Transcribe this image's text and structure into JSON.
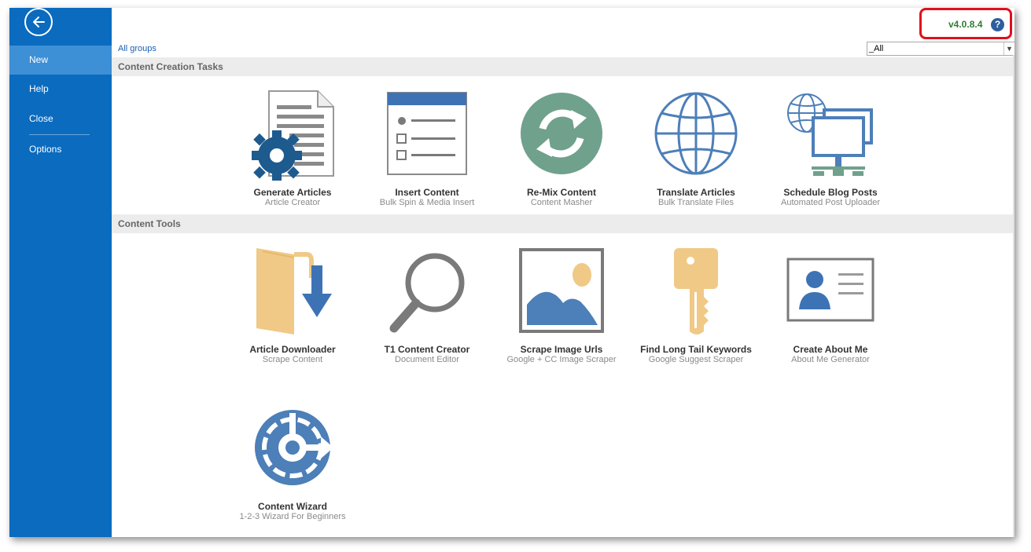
{
  "sidebar": {
    "items": [
      {
        "label": "New"
      },
      {
        "label": "Help"
      },
      {
        "label": "Close"
      },
      {
        "label": "Options"
      }
    ]
  },
  "header": {
    "version": "v4.0.8.4",
    "help_symbol": "?",
    "all_groups_link": "All groups",
    "group_filter_value": "_All"
  },
  "sections": [
    {
      "title": "Content Creation Tasks",
      "tiles": [
        {
          "title": "Generate Articles",
          "subtitle": "Article Creator",
          "icon": "document-gear-icon"
        },
        {
          "title": "Insert Content",
          "subtitle": "Bulk Spin & Media Insert",
          "icon": "checklist-icon"
        },
        {
          "title": "Re-Mix Content",
          "subtitle": "Content Masher",
          "icon": "refresh-circle-icon"
        },
        {
          "title": "Translate Articles",
          "subtitle": "Bulk Translate Files",
          "icon": "globe-icon"
        },
        {
          "title": "Schedule Blog Posts",
          "subtitle": "Automated Post Uploader",
          "icon": "network-monitors-icon"
        }
      ]
    },
    {
      "title": "Content Tools",
      "tiles": [
        {
          "title": "Article Downloader",
          "subtitle": "Scrape Content",
          "icon": "folder-download-icon"
        },
        {
          "title": "T1 Content Creator",
          "subtitle": "Document Editor",
          "icon": "magnifier-icon"
        },
        {
          "title": "Scrape Image Urls",
          "subtitle": "Google + CC Image Scraper",
          "icon": "image-icon"
        },
        {
          "title": "Find Long Tail Keywords",
          "subtitle": "Google Suggest Scraper",
          "icon": "key-icon"
        },
        {
          "title": "Create About Me",
          "subtitle": "About Me Generator",
          "icon": "id-card-icon"
        },
        {
          "title": "Content Wizard",
          "subtitle": "1-2-3 Wizard For Beginners",
          "icon": "wizard-clock-icon"
        }
      ]
    }
  ],
  "colors": {
    "sidebar_blue": "#0a6bbf",
    "sidebar_active": "#3d8fd6",
    "icon_navy": "#1d5a8e",
    "icon_blue": "#4d7fb8",
    "icon_teal": "#6fa18c",
    "icon_tan": "#f0c987",
    "icon_gray": "#7a7a7a",
    "version_green": "#2f7d32",
    "highlight_red": "#e0101a"
  }
}
